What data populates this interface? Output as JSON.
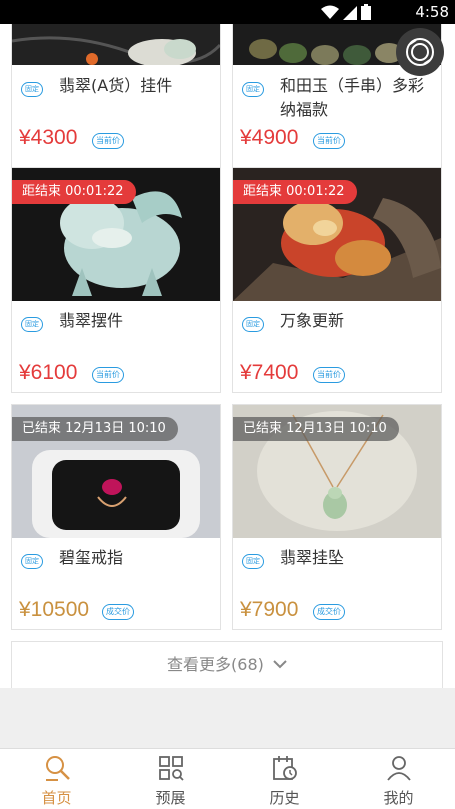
{
  "status_bar": {
    "time": "4:58"
  },
  "cards": [
    {
      "title": "翡翠(A货）挂件",
      "price": "¥4300",
      "price_label": "当前价",
      "badge": "固定",
      "price_color": "#e43b3b"
    },
    {
      "title": "和田玉（手串）多彩纳福款",
      "price": "¥4900",
      "price_label": "当前价",
      "badge": "固定",
      "price_color": "#e43b3b"
    },
    {
      "title": "翡翠摆件",
      "price": "¥6100",
      "price_label": "当前价",
      "badge": "固定",
      "tag": "距结束 00:01:22",
      "price_color": "#e43b3b"
    },
    {
      "title": "万象更新",
      "price": "¥7400",
      "price_label": "当前价",
      "badge": "固定",
      "tag": "距结束 00:01:22",
      "price_color": "#e43b3b"
    },
    {
      "title": "碧玺戒指",
      "price": "¥10500",
      "price_label": "成交价",
      "badge": "固定",
      "tag": "已结束 12月13日 10:10",
      "price_color": "#c9913f"
    },
    {
      "title": "翡翠挂坠",
      "price": "¥7900",
      "price_label": "成交价",
      "badge": "固定",
      "tag": "已结束 12月13日 10:10",
      "price_color": "#c9913f"
    }
  ],
  "load_more": "查看更多(68)",
  "tabs": [
    {
      "label": "首页",
      "icon": "auction-hammer-icon",
      "active": true
    },
    {
      "label": "预展",
      "icon": "grid-search-icon",
      "active": false
    },
    {
      "label": "历史",
      "icon": "calendar-clock-icon",
      "active": false
    },
    {
      "label": "我的",
      "icon": "user-icon",
      "active": false
    }
  ],
  "colors": {
    "accent": "#d69144",
    "live_tag": "#e43b3b",
    "badge_blue": "#2a9be0",
    "sold_price": "#c9913f"
  }
}
